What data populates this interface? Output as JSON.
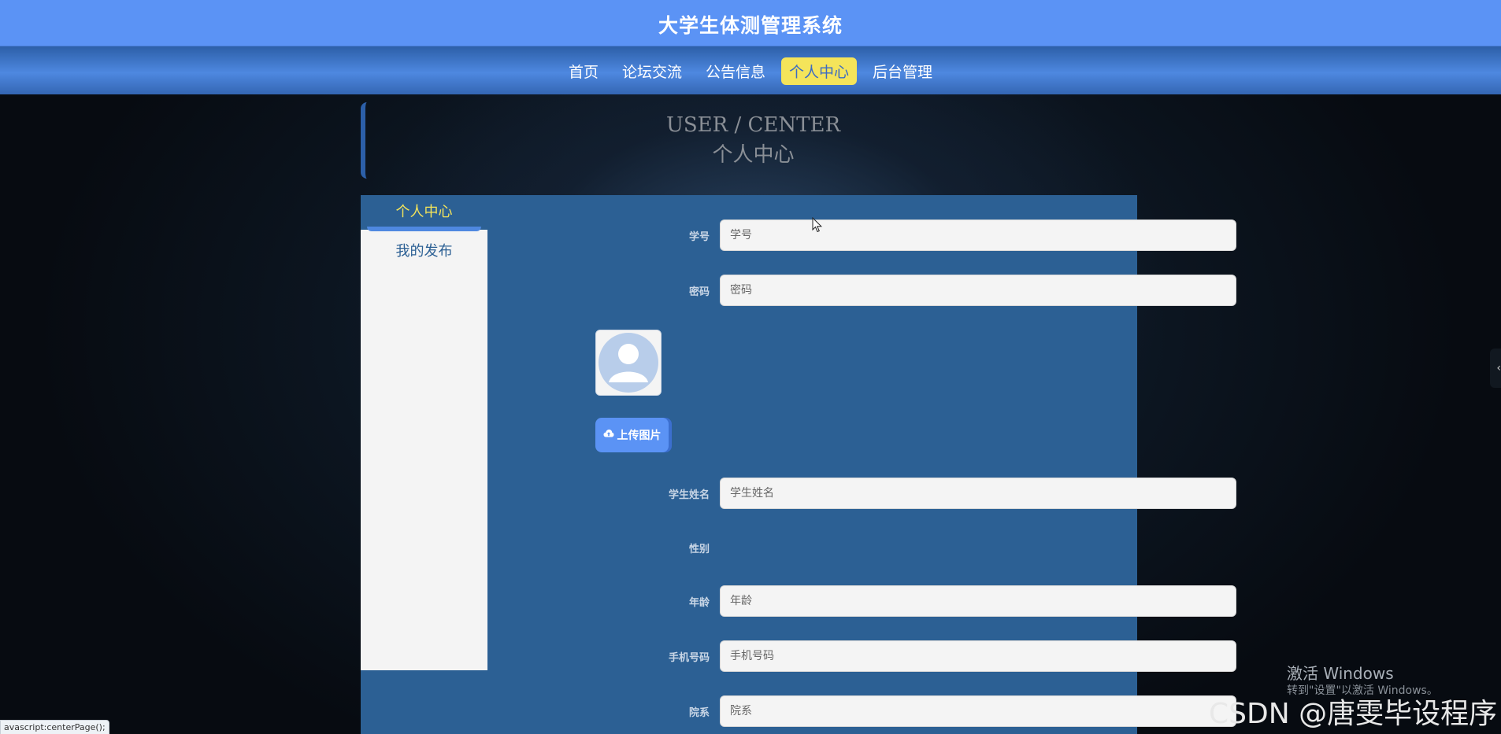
{
  "header": {
    "site_title": "大学生体测管理系统"
  },
  "nav": {
    "items": [
      {
        "label": "首页",
        "active": false
      },
      {
        "label": "论坛交流",
        "active": false
      },
      {
        "label": "公告信息",
        "active": false
      },
      {
        "label": "个人中心",
        "active": true
      },
      {
        "label": "后台管理",
        "active": false
      }
    ]
  },
  "section": {
    "title_en": "USER / CENTER",
    "title_cn": "个人中心"
  },
  "sidebar": {
    "items": [
      {
        "label": "个人中心",
        "active": true
      },
      {
        "label": "我的发布",
        "active": false
      }
    ]
  },
  "form": {
    "student_id": {
      "label": "学号",
      "placeholder": "学号"
    },
    "password": {
      "label": "密码",
      "placeholder": "密码"
    },
    "upload_label": "上传图片",
    "student_name": {
      "label": "学生姓名",
      "placeholder": "学生姓名"
    },
    "gender": {
      "label": "性别"
    },
    "age": {
      "label": "年龄",
      "placeholder": "年龄"
    },
    "phone": {
      "label": "手机号码",
      "placeholder": "手机号码"
    },
    "department": {
      "label": "院系",
      "placeholder": "院系"
    }
  },
  "overlay": {
    "windows_line1": "激活 Windows",
    "windows_line2": "转到\"设置\"以激活 Windows。",
    "csdn": "CSDN @唐雯毕设程序",
    "status_text": "avascript:centerPage();"
  },
  "colors": {
    "header_blue": "#5b93f5",
    "panel_blue": "#2c6094",
    "active_yellow": "#f4e45a"
  },
  "icons": {
    "upload": "cloud-upload-icon",
    "avatar": "user-avatar-icon",
    "handle": "chevron-left-icon"
  }
}
